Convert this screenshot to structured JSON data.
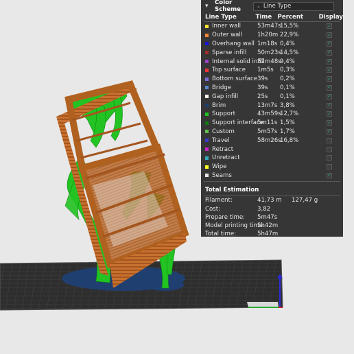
{
  "header": {
    "title": "Color Scheme",
    "scheme_value": "Line Type"
  },
  "columns": {
    "type": "Line Type",
    "time": "Time",
    "percent": "Percent",
    "display": "Display"
  },
  "line_types": [
    {
      "name": "Inner wall",
      "time": "53m47s",
      "percent": "15,5%",
      "color": "#ffe433",
      "checked": true
    },
    {
      "name": "Outer wall",
      "time": "1h20m",
      "percent": "22,9%",
      "color": "#f0883a",
      "checked": true
    },
    {
      "name": "Overhang wall",
      "time": "1m18s",
      "percent": "0,4%",
      "color": "#1414d8",
      "checked": true
    },
    {
      "name": "Sparse infill",
      "time": "50m23s",
      "percent": "14,5%",
      "color": "#a52a2a",
      "checked": true
    },
    {
      "name": "Internal solid infill",
      "time": "32m48s",
      "percent": "9,4%",
      "color": "#9b42c8",
      "checked": true
    },
    {
      "name": "Top surface",
      "time": "1m5s",
      "percent": "0,3%",
      "color": "#ee3333",
      "checked": true
    },
    {
      "name": "Bottom surface",
      "time": "39s",
      "percent": "0,2%",
      "color": "#7d6ad8",
      "checked": true
    },
    {
      "name": "Bridge",
      "time": "39s",
      "percent": "0,1%",
      "color": "#5a86c8",
      "checked": true
    },
    {
      "name": "Gap infill",
      "time": "25s",
      "percent": "0,1%",
      "color": "#ffffff",
      "checked": true
    },
    {
      "name": "Brim",
      "time": "13m7s",
      "percent": "3,8%",
      "color": "#1f3f70",
      "checked": true
    },
    {
      "name": "Support",
      "time": "43m59s",
      "percent": "12,7%",
      "color": "#22c322",
      "checked": true
    },
    {
      "name": "Support interface",
      "time": "5m11s",
      "percent": "1,5%",
      "color": "#0f7a12",
      "checked": true
    },
    {
      "name": "Custom",
      "time": "5m57s",
      "percent": "1,7%",
      "color": "#5fbf4a",
      "checked": true
    },
    {
      "name": "Travel",
      "time": "58m26s",
      "percent": "16,8%",
      "color": "#3a3acc",
      "checked": false
    },
    {
      "name": "Retract",
      "time": "",
      "percent": "",
      "color": "#cc22cc",
      "checked": false
    },
    {
      "name": "Unretract",
      "time": "",
      "percent": "",
      "color": "#3aa8c0",
      "checked": false
    },
    {
      "name": "Wipe",
      "time": "",
      "percent": "",
      "color": "#ffff22",
      "checked": false
    },
    {
      "name": "Seams",
      "time": "",
      "percent": "",
      "color": "#e8e8e8",
      "checked": true
    }
  ],
  "estimation": {
    "title": "Total Estimation",
    "rows": [
      {
        "label": "Filament:",
        "value": "41,73 m",
        "value2": "127,47 g"
      },
      {
        "label": "Cost:",
        "value": "3,82",
        "value2": ""
      },
      {
        "label": "Prepare time:",
        "value": "5m47s",
        "value2": ""
      },
      {
        "label": "Model printing time:",
        "value": "5h42m",
        "value2": ""
      },
      {
        "label": "Total time:",
        "value": "5h47m",
        "value2": ""
      }
    ]
  },
  "check_glyph": "✓",
  "colors": {
    "panel_bg": "#363636",
    "viewport_bg": "#e8e8e8",
    "check": "#2aa86a"
  },
  "icons": {
    "collapse": "chevron-down-icon",
    "select": "chevron-down-icon"
  }
}
